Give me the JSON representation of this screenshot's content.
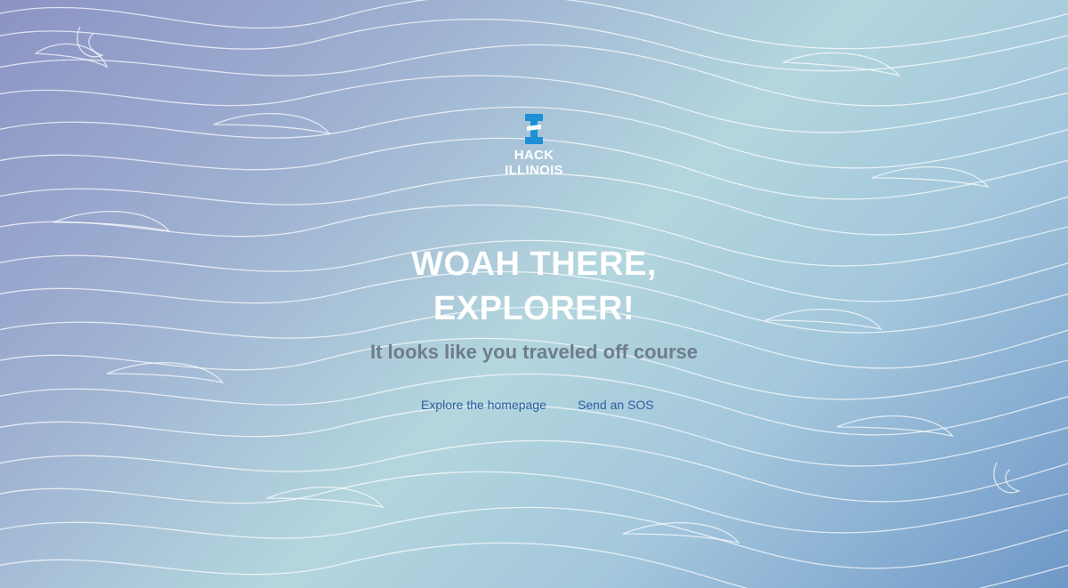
{
  "logo": {
    "line1": "HACK",
    "line2": "ILLINOIS",
    "icon": "illinois-i-icon",
    "color": "#1e90d6"
  },
  "headline": {
    "line1": "WOAH THERE,",
    "line2": "EXPLORER!"
  },
  "subheadline": "It looks like you traveled off course",
  "links": {
    "homepage": "Explore the homepage",
    "sos": "Send an SOS"
  },
  "colors": {
    "headline": "#ffffff",
    "subheadline": "#6e7d8a",
    "link": "#2e5fa0",
    "background_start": "#8c93c4",
    "background_mid": "#b3d6de",
    "background_end": "#6f98c8"
  }
}
